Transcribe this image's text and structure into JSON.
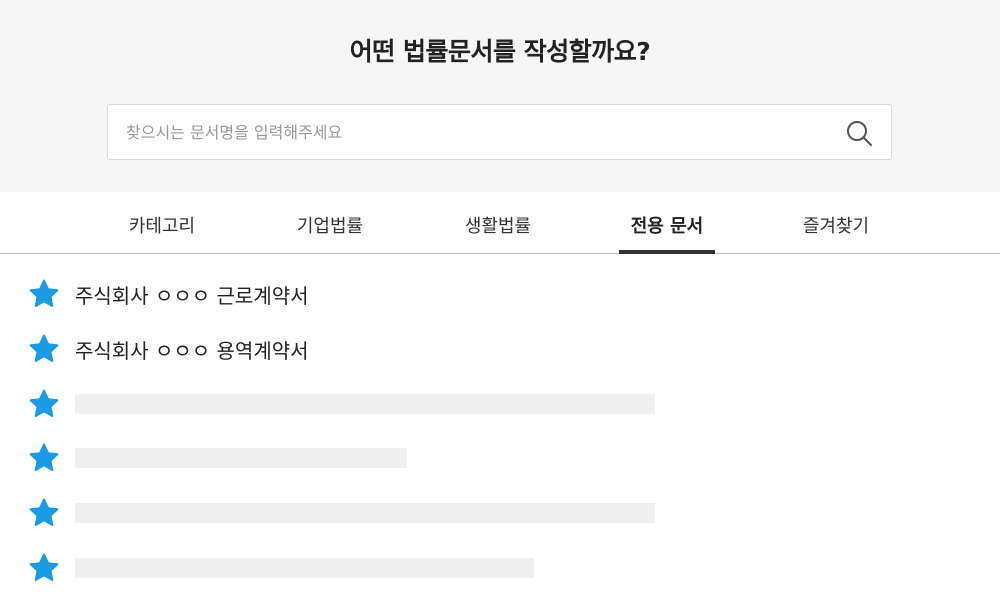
{
  "header": {
    "title": "어떤 법률문서를 작성할까요?"
  },
  "search": {
    "value": "",
    "placeholder": "찾으시는 문서명을 입력해주세요",
    "icon": "search-icon"
  },
  "tabs": [
    {
      "label": "카테고리",
      "active": false
    },
    {
      "label": "기업법률",
      "active": false
    },
    {
      "label": "생활법률",
      "active": false
    },
    {
      "label": "전용 문서",
      "active": true
    },
    {
      "label": "즐겨찾기",
      "active": false
    }
  ],
  "documents": [
    {
      "title": "주식회사 ㅇㅇㅇ 근로계약서",
      "starred": true
    },
    {
      "title": "주식회사 ㅇㅇㅇ 용역계약서",
      "starred": true
    }
  ],
  "colors": {
    "star": "#1a9be6",
    "hero_bg": "#f6f6f6",
    "placeholder_bar": "#efefef",
    "active_tab": "#333333"
  }
}
